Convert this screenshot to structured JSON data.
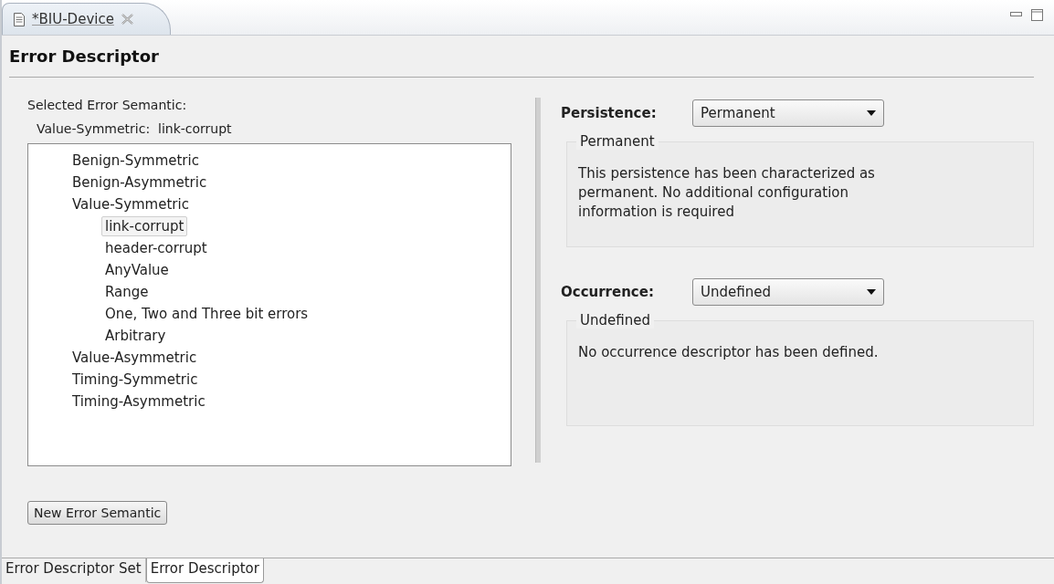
{
  "editor_tab": {
    "title": "*BIU-Device",
    "dirty": true
  },
  "header": "Error Descriptor",
  "selected_semantic": {
    "label": "Selected Error Semantic:",
    "value": "Value-Symmetric:  link-corrupt"
  },
  "tree": [
    {
      "label": "Benign-Symmetric",
      "selected": false
    },
    {
      "label": "Benign-Asymmetric",
      "selected": false
    },
    {
      "label": "Value-Symmetric",
      "selected": false,
      "children": [
        {
          "label": "link-corrupt",
          "selected": true
        },
        {
          "label": "header-corrupt",
          "selected": false
        },
        {
          "label": "AnyValue",
          "selected": false
        },
        {
          "label": "Range",
          "selected": false
        },
        {
          "label": "One, Two and Three bit errors",
          "selected": false
        },
        {
          "label": "Arbitrary",
          "selected": false
        }
      ]
    },
    {
      "label": "Value-Asymmetric",
      "selected": false
    },
    {
      "label": "Timing-Symmetric",
      "selected": false
    },
    {
      "label": "Timing-Asymmetric",
      "selected": false
    }
  ],
  "new_button": "New Error Semantic",
  "persistence": {
    "label": "Persistence:",
    "value": "Permanent",
    "group_title": "Permanent",
    "description": "This persistence has been characterized as permanent.  No additional configuration information is required"
  },
  "occurrence": {
    "label": "Occurrence:",
    "value": "Undefined",
    "group_title": "Undefined",
    "description": "No occurrence descriptor has been defined."
  },
  "bottom_tabs": [
    {
      "label": "Error Descriptor Set",
      "selected": false
    },
    {
      "label": "Error Descriptor",
      "selected": true
    }
  ]
}
